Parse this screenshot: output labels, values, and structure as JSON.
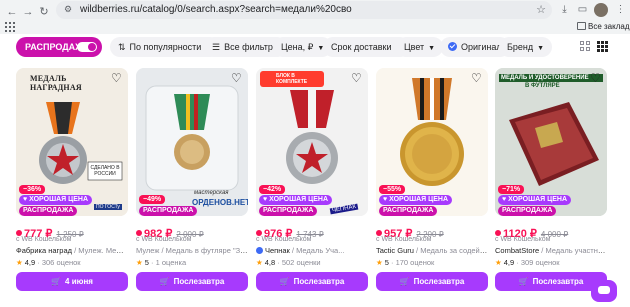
{
  "browser": {
    "url": "wildberries.ru/catalog/0/search.aspx?search=медали%20сво",
    "all_bookmarks": "Все закладки"
  },
  "filters": {
    "sale_label": "РАСПРОДАЖА",
    "sort_label": "По популярности",
    "all_filters": "Все фильтры",
    "price": "Цена, ₽",
    "delivery": "Срок доставки",
    "color": "Цвет",
    "original": "Оригинал",
    "brand": "Бренд"
  },
  "cards": [
    {
      "discount": "−36%",
      "good_price": "ХОРОШАЯ ЦЕНА",
      "sale": "РАСПРОДАЖА",
      "price": "777 ₽",
      "old_price": "1 250 ₽",
      "wallet": "с WB Кошельком",
      "brand": "Фабрика наград",
      "name": "Мулеж. Медаль",
      "rating": "4,9",
      "reviews": "306 оценок",
      "button": "4 июня",
      "image_text": "МЕДАЛЬ НАГРАДНАЯ",
      "image_text2": "СДЕЛАНО В РОССИИ",
      "image_text3": "ПО ГОСТу"
    },
    {
      "discount": "−49%",
      "good_price": "",
      "sale": "РАСПРОДАЖА",
      "price": "982 ₽",
      "old_price": "2 000 ₽",
      "wallet": "с WB Кошельком",
      "brand": "Мулеж",
      "name": "Медаль в футляре \"За с...",
      "rating": "5",
      "reviews": "1 оценка",
      "button": "Послезавтра",
      "image_text": "мастерская",
      "image_text2": "ОРДЕНОВ.НЕТ"
    },
    {
      "discount": "−42%",
      "good_price": "ХОРОШАЯ ЦЕНА",
      "sale": "РАСПРОДАЖА",
      "price": "976 ₽",
      "old_price": "1 743 ₽",
      "wallet": "с WB Кошельком",
      "brand": "Чепнак",
      "name": "Медаль Уча...",
      "rating": "4,8",
      "reviews": "502 оценки",
      "button": "Послезавтра",
      "image_text": "БЛОК В КОМПЛЕКТЕ",
      "image_text2": "ЧЕПНАК"
    },
    {
      "discount": "−55%",
      "good_price": "ХОРОШАЯ ЦЕНА",
      "sale": "РАСПРОДАЖА",
      "price": "957 ₽",
      "old_price": "2 200 ₽",
      "wallet": "с WB Кошельком",
      "brand": "Tactic Guru",
      "name": "Медаль за содейст...",
      "rating": "5",
      "reviews": "170 оценок",
      "button": "Послезавтра"
    },
    {
      "discount": "−71%",
      "good_price": "ХОРОШАЯ ЦЕНА",
      "sale": "РАСПРОДАЖА",
      "price": "1120 ₽",
      "old_price": "4 000 ₽",
      "wallet": "с WB Кошельком",
      "brand": "CombatStore",
      "name": "Медаль участник...",
      "rating": "4,9",
      "reviews": "309 оценок",
      "button": "Послезавтра",
      "image_text": "МЕДАЛЬ И УДОСТОВЕРЕНИЕ",
      "image_text2": "В ФУТЛЯРЕ"
    }
  ],
  "colors": {
    "accent": "#cb11ab",
    "button": "#a73afd",
    "price": "#f91155"
  }
}
